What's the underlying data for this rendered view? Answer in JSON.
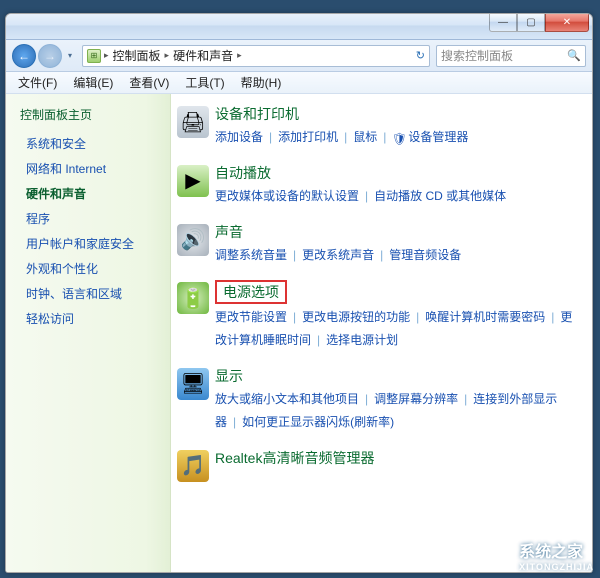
{
  "window": {
    "minimize": "—",
    "maximize": "▢",
    "close": "✕"
  },
  "nav": {
    "back": "←",
    "forward": "→",
    "dropdown": "▾",
    "refresh": "↻"
  },
  "breadcrumb": {
    "seg1": "控制面板",
    "seg2": "硬件和声音"
  },
  "search": {
    "placeholder": "搜索控制面板",
    "icon": "🔍"
  },
  "menu": {
    "file": "文件(F)",
    "edit": "编辑(E)",
    "view": "查看(V)",
    "tools": "工具(T)",
    "help": "帮助(H)"
  },
  "sidebar": {
    "home": "控制面板主页",
    "items": [
      {
        "label": "系统和安全",
        "active": false
      },
      {
        "label": "网络和 Internet",
        "active": false
      },
      {
        "label": "硬件和声音",
        "active": true
      },
      {
        "label": "程序",
        "active": false
      },
      {
        "label": "用户帐户和家庭安全",
        "active": false
      },
      {
        "label": "外观和个性化",
        "active": false
      },
      {
        "label": "时钟、语言和区域",
        "active": false
      },
      {
        "label": "轻松访问",
        "active": false
      }
    ]
  },
  "categories": [
    {
      "title": "设备和打印机",
      "highlighted": false,
      "links": [
        {
          "text": "添加设备"
        },
        {
          "text": "添加打印机"
        },
        {
          "text": "鼠标"
        },
        {
          "text": "设备管理器",
          "icon": "shield"
        }
      ]
    },
    {
      "title": "自动播放",
      "highlighted": false,
      "links": [
        {
          "text": "更改媒体或设备的默认设置"
        },
        {
          "text": "自动播放 CD 或其他媒体"
        }
      ]
    },
    {
      "title": "声音",
      "highlighted": false,
      "links": [
        {
          "text": "调整系统音量"
        },
        {
          "text": "更改系统声音"
        },
        {
          "text": "管理音频设备"
        }
      ]
    },
    {
      "title": "电源选项",
      "highlighted": true,
      "links": [
        {
          "text": "更改节能设置"
        },
        {
          "text": "更改电源按钮的功能"
        },
        {
          "text": "唤醒计算机时需要密码"
        },
        {
          "text": "更改计算机睡眠时间"
        },
        {
          "text": "选择电源计划"
        }
      ]
    },
    {
      "title": "显示",
      "highlighted": false,
      "links": [
        {
          "text": "放大或缩小文本和其他项目"
        },
        {
          "text": "调整屏幕分辨率"
        },
        {
          "text": "连接到外部显示器"
        },
        {
          "text": "如何更正显示器闪烁(刷新率)"
        }
      ]
    },
    {
      "title": "Realtek高清晰音频管理器",
      "highlighted": false,
      "links": []
    }
  ],
  "icons": {
    "shield": "🛡"
  },
  "watermark": {
    "line1": "系统之家",
    "line2": "XITONGZHIJIA"
  }
}
